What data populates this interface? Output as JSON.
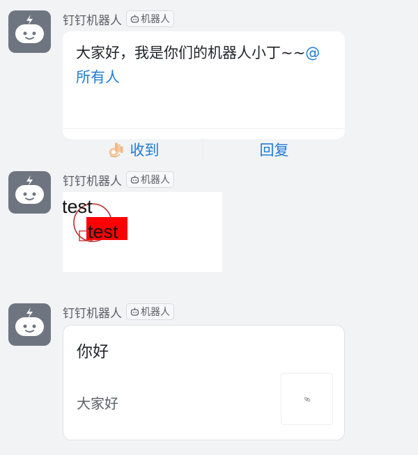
{
  "messages": [
    {
      "sender": "钉钉机器人",
      "robot_tag": "机器人",
      "card": {
        "text": "大家好，我是你们的机器人小丁~~",
        "mention": "@所有人",
        "buttons": [
          {
            "label": "收到",
            "icon": "ok-hand-icon"
          },
          {
            "label": "回复"
          }
        ]
      }
    },
    {
      "sender": "钉钉机器人",
      "robot_tag": "机器人",
      "image": {
        "text_top": "test",
        "text_highlight": "test",
        "highlight_color": "#ff0000"
      }
    },
    {
      "sender": "钉钉机器人",
      "robot_tag": "机器人",
      "link_card": {
        "title": "你好",
        "description": "大家好",
        "thumbnail": "broken-link-icon"
      }
    }
  ],
  "colors": {
    "background": "#f2f3f5",
    "avatar": "#6f7580",
    "accent": "#1e7bd8"
  }
}
